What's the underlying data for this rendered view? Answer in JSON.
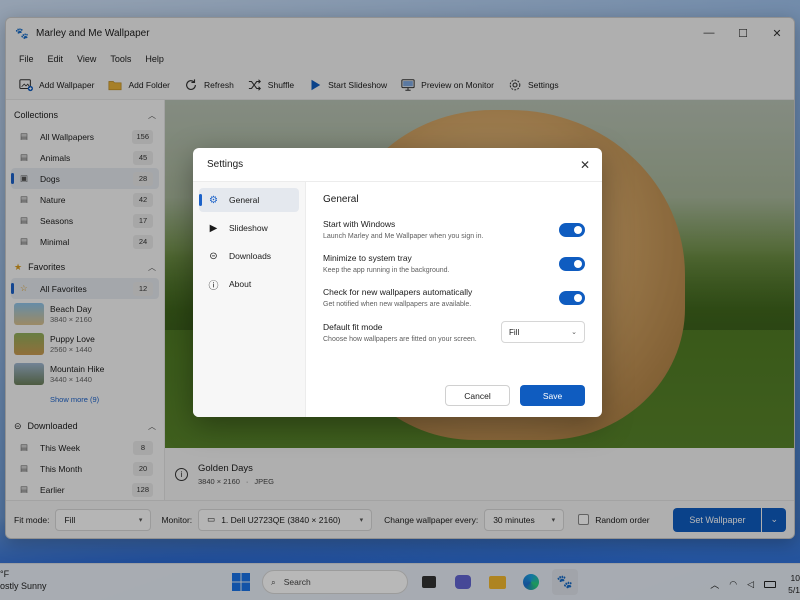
{
  "window": {
    "title": "Marley and Me Wallpaper"
  },
  "menu": [
    "File",
    "Edit",
    "View",
    "Tools",
    "Help"
  ],
  "toolbar": {
    "add_wallpaper": "Add Wallpaper",
    "add_folder": "Add Folder",
    "refresh": "Refresh",
    "shuffle": "Shuffle",
    "start_slideshow": "Start Slideshow",
    "preview_on_monitor": "Preview on Monitor",
    "settings": "Settings"
  },
  "sidebar": {
    "collections_header": "Collections",
    "collections": [
      {
        "label": "All Wallpapers",
        "count": "156"
      },
      {
        "label": "Animals",
        "count": "45"
      },
      {
        "label": "Dogs",
        "count": "28"
      },
      {
        "label": "Nature",
        "count": "42"
      },
      {
        "label": "Seasons",
        "count": "17"
      },
      {
        "label": "Minimal",
        "count": "24"
      }
    ],
    "favorites_header": "Favorites",
    "all_favorites": {
      "label": "All Favorites",
      "count": "12"
    },
    "favorites": [
      {
        "name": "Beach Day",
        "dims": "3840 × 2160"
      },
      {
        "name": "Puppy Love",
        "dims": "2560 × 1440"
      },
      {
        "name": "Mountain Hike",
        "dims": "3440 × 1440"
      }
    ],
    "show_more": "Show more (9)",
    "downloaded_header": "Downloaded",
    "downloaded": [
      {
        "label": "This Week",
        "count": "8"
      },
      {
        "label": "This Month",
        "count": "20"
      },
      {
        "label": "Earlier",
        "count": "128"
      }
    ]
  },
  "image_info": {
    "name": "Golden Days",
    "dims": "3840 × 2160",
    "format": "JPEG"
  },
  "bottom": {
    "fit_mode_label": "Fit mode:",
    "fit_mode_value": "Fill",
    "monitor_label": "Monitor:",
    "monitor_value": "1. Dell U2723QE (3840 × 2160)",
    "change_label": "Change wallpaper every:",
    "change_value": "30 minutes",
    "random_order": "Random order",
    "set_wallpaper": "Set Wallpaper"
  },
  "dialog": {
    "title": "Settings",
    "nav": [
      "General",
      "Slideshow",
      "Downloads",
      "About"
    ],
    "section_title": "General",
    "settings": [
      {
        "title": "Start with Windows",
        "desc": "Launch Marley and Me Wallpaper when you sign in.",
        "on": true
      },
      {
        "title": "Minimize to system tray",
        "desc": "Keep the app running in the background.",
        "on": true
      },
      {
        "title": "Check for new wallpapers automatically",
        "desc": "Get notified when new wallpapers are available.",
        "on": true
      }
    ],
    "fit": {
      "title": "Default fit mode",
      "desc": "Choose how wallpapers are fitted on your screen.",
      "value": "Fill"
    },
    "cancel": "Cancel",
    "save": "Save"
  },
  "taskbar": {
    "weather_temp": "°F",
    "weather_desc": "ostly Sunny",
    "search_placeholder": "Search",
    "clock_time": "10",
    "clock_date": "5/1"
  },
  "colors": {
    "accent": "#0f5cc0"
  }
}
